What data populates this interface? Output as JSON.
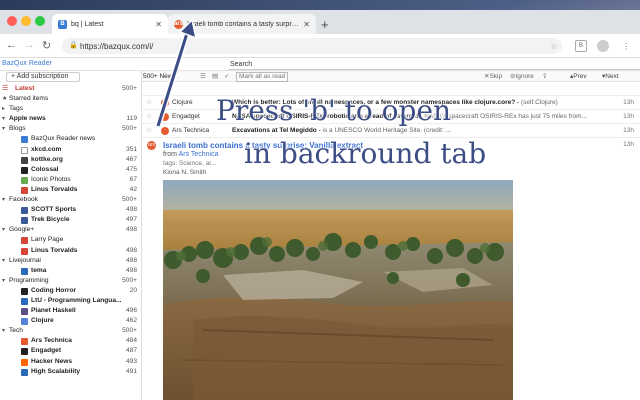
{
  "browser": {
    "tabs": [
      {
        "label": "bq | Latest",
        "favicon": "bazqux-icon",
        "active": true
      },
      {
        "label": "Israeli tomb contains a tasty surprise: Vanilla extract",
        "favicon": "ars-icon",
        "active": false
      }
    ],
    "url": "https://bazqux.com/i/",
    "new_tab": "+"
  },
  "app": {
    "brand": "BazQux Reader",
    "search_placeholder": "Search",
    "add_subscription": "+ Add subscription"
  },
  "sidebar": {
    "items": [
      {
        "label": "Latest",
        "count": "500+",
        "kind": "latest"
      },
      {
        "label": "Starred items",
        "count": "",
        "kind": "group",
        "icon": "star-icon"
      },
      {
        "label": "Tags",
        "count": "",
        "kind": "group",
        "icon": "tag-icon"
      },
      {
        "label": "Apple news",
        "count": "119",
        "kind": "group-bold"
      },
      {
        "label": "Blogs",
        "count": "500+",
        "kind": "group"
      },
      {
        "label": "BazQux Reader news",
        "count": "",
        "kind": "sub",
        "color": "#3a7bd5",
        "icon": "bazqux-icon"
      },
      {
        "label": "xkcd.com",
        "count": "351",
        "kind": "sub-bold",
        "color": "#ffffff",
        "icon": "xkcd-icon"
      },
      {
        "label": "kottke.org",
        "count": "467",
        "kind": "sub-bold",
        "color": "#444444",
        "icon": "kottke-icon"
      },
      {
        "label": "Colossal",
        "count": "475",
        "kind": "sub-bold",
        "color": "#222222",
        "icon": "colossal-icon"
      },
      {
        "label": "Iconic Photos",
        "count": "67",
        "kind": "sub",
        "color": "#6aa84f",
        "icon": "iconic-icon"
      },
      {
        "label": "Linus Torvalds",
        "count": "42",
        "kind": "sub-bold",
        "color": "#d44638",
        "icon": "gplus-icon"
      },
      {
        "label": "Facebook",
        "count": "500+",
        "kind": "group"
      },
      {
        "label": "SCOTT Sports",
        "count": "498",
        "kind": "sub-bold",
        "color": "#3b5998",
        "icon": "facebook-icon"
      },
      {
        "label": "Trek Bicycle",
        "count": "497",
        "kind": "sub-bold",
        "color": "#3b5998",
        "icon": "facebook-icon"
      },
      {
        "label": "Google+",
        "count": "498",
        "kind": "group"
      },
      {
        "label": "Larry Page",
        "count": "",
        "kind": "sub",
        "color": "#d44638",
        "icon": "gplus-icon"
      },
      {
        "label": "Linus Torvalds",
        "count": "498",
        "kind": "sub-bold",
        "color": "#d44638",
        "icon": "gplus-icon"
      },
      {
        "label": "Livejournal",
        "count": "498",
        "kind": "group"
      },
      {
        "label": "tema",
        "count": "498",
        "kind": "sub-bold",
        "color": "#2a6ab8",
        "icon": "lj-icon"
      },
      {
        "label": "Programming",
        "count": "500+",
        "kind": "group"
      },
      {
        "label": "Coding Horror",
        "count": "20",
        "kind": "sub-bold",
        "color": "#222222",
        "icon": "codinghorror-icon"
      },
      {
        "label": "LtU - Programming Langua...",
        "count": "",
        "kind": "sub-bold",
        "color": "#2a6ab8",
        "icon": "ltu-icon"
      },
      {
        "label": "Planet Haskell",
        "count": "496",
        "kind": "sub-bold",
        "color": "#5e5086",
        "icon": "haskell-icon"
      },
      {
        "label": "Clojure",
        "count": "462",
        "kind": "sub-bold",
        "color": "#5881d8",
        "icon": "clojure-icon"
      },
      {
        "label": "Tech",
        "count": "500+",
        "kind": "group"
      },
      {
        "label": "Ars Technica",
        "count": "484",
        "kind": "sub-bold",
        "color": "#e55b2e",
        "icon": "ars-icon"
      },
      {
        "label": "Engadget",
        "count": "487",
        "kind": "sub-bold",
        "color": "#222222",
        "icon": "engadget-icon"
      },
      {
        "label": "Hacker News",
        "count": "493",
        "kind": "sub-bold",
        "color": "#ff6600",
        "icon": "hn-icon"
      },
      {
        "label": "High Scalability",
        "count": "491",
        "kind": "sub-bold",
        "color": "#2a6ab8",
        "icon": "hs-icon"
      }
    ]
  },
  "toolbar": {
    "count_label": "500+ New",
    "mark_all": "Mark all as read",
    "skip": "Skip",
    "ignore": "Ignore",
    "prev": "Prev",
    "next": "Next"
  },
  "rows": [
    {
      "source": "Clojure",
      "title": "Which is better: Lots of small namespaces, or a few monster namespaces like clojure.core?",
      "snippet": "(self.Clojure)",
      "time": "13h"
    },
    {
      "source": "Engadget",
      "title": "NASA spacecraft OSIRIS-REx: robotic arm ahead of asteroid",
      "snippet": "NASA's spacecraft OSIRIS-REx has just 75 miles from...",
      "time": "13h"
    },
    {
      "source": "Ars Technica",
      "title": "Excavations at Tel Megiddo",
      "snippet": "is a UNESCO World Heritage Site. (credit: ...",
      "time": "13h"
    }
  ],
  "article": {
    "title": "Israeli tomb contains a tasty surprise: Vanilla extract",
    "from_prefix": "from",
    "source": "Ars Technica",
    "tags": "tags: Science, ar...",
    "author": "Kiona N. Smith",
    "time": "13h"
  },
  "overlay": {
    "line1": "Press 'b' to open",
    "line2": "in backround tab"
  },
  "colors": {
    "accent": "#3a6fd0",
    "latest": "#c0392b",
    "overlay_text": "#3d4e86"
  }
}
